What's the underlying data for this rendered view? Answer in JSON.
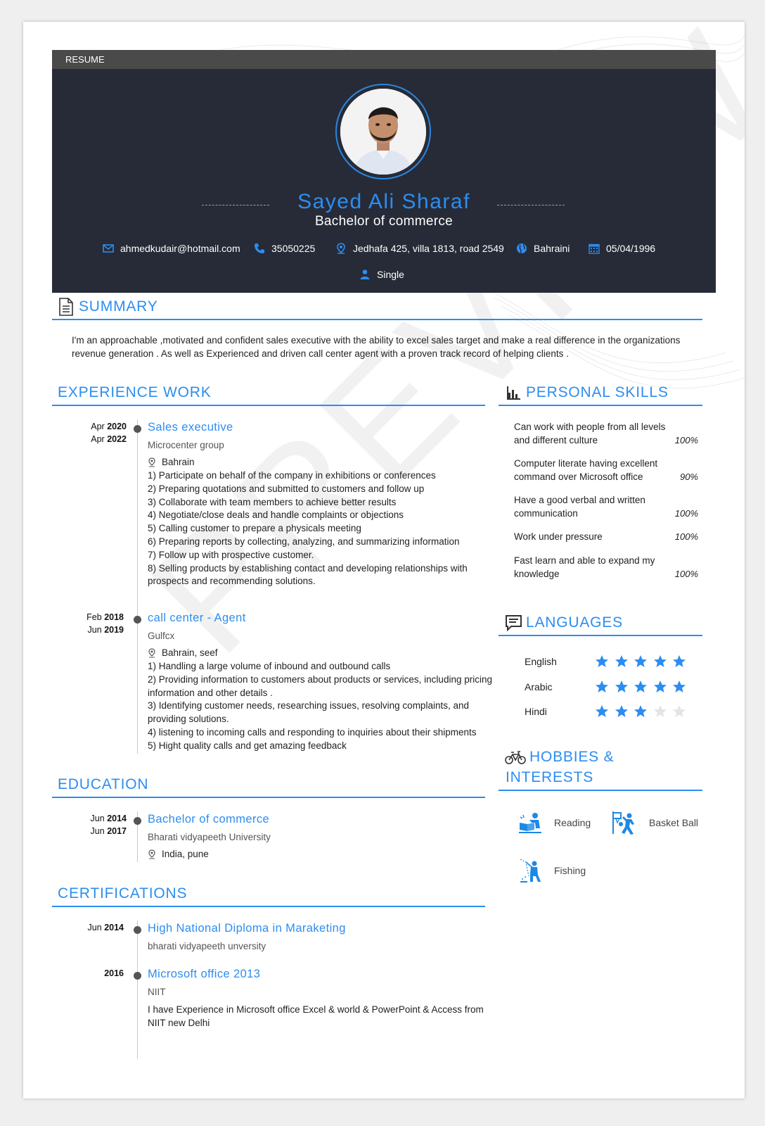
{
  "watermark": "PREVIEW",
  "topbar": {
    "label": "RESUME"
  },
  "header": {
    "name": "Sayed Ali Sharaf",
    "degree": "Bachelor of commerce",
    "email": "ahmedkudair@hotmail.com",
    "phone": "35050225",
    "address": "Jedhafa 425, villa 1813, road 2549",
    "nationality": "Bahraini",
    "dob": "05/04/1996",
    "marital": "Single"
  },
  "summary": {
    "title": "SUMMARY",
    "text": "I'm an approachable ,motivated and confident sales executive with the ability to excel sales target and make a real difference in the organizations revenue generation . As well as Experienced and driven call center agent with a proven track record of helping clients ."
  },
  "experience": {
    "title": "EXPERIENCE WORK",
    "jobs": [
      {
        "from_month": "Apr",
        "from_year": "2020",
        "to_month": "Apr",
        "to_year": "2022",
        "title": "Sales executive",
        "company": "Microcenter group",
        "location": "Bahrain",
        "duties": [
          "1) Participate on behalf of the company in exhibitions or conferences",
          "2) Preparing quotations and submitted to customers and follow up",
          "3) Collaborate with team members to achieve better results",
          "4) Negotiate/close deals and handle complaints or objections",
          "5) Calling customer to prepare a physicals meeting",
          "6) Preparing reports by collecting, analyzing, and summarizing information",
          "7) Follow up with prospective customer.",
          "8) Selling products by establishing contact and developing relationships with prospects and recommending solutions."
        ]
      },
      {
        "from_month": "Feb",
        "from_year": "2018",
        "to_month": "Jun",
        "to_year": "2019",
        "title": "call center - Agent",
        "company": "Gulfcx",
        "location": "Bahrain, seef",
        "duties": [
          "1) Handling a large volume of inbound and outbound calls",
          "2) Providing information to customers about products or services, including pricing information and other details .",
          "3) Identifying customer needs, researching issues, resolving complaints, and providing solutions.",
          "4) listening to incoming calls and responding to inquiries about their shipments",
          "5) Hight quality calls and get amazing feedback"
        ]
      }
    ]
  },
  "education": {
    "title": "EDUCATION",
    "items": [
      {
        "from_month": "Jun",
        "from_year": "2014",
        "to_month": "Jun",
        "to_year": "2017",
        "title": "Bachelor of commerce",
        "school": "Bharati vidyapeeth University",
        "location": "India, pune"
      }
    ]
  },
  "certifications": {
    "title": "CERTIFICATIONS",
    "items": [
      {
        "month": "Jun",
        "year": "2014",
        "title": "High National Diploma in Maraketing",
        "org": "bharati vidyapeeth unversity",
        "desc": ""
      },
      {
        "month": "",
        "year": "2016",
        "title": "Microsoft office 2013",
        "org": "NIIT",
        "desc": "I have Experience in Microsoft office Excel & world & PowerPoint & Access from NIIT new Delhi"
      }
    ]
  },
  "skills": {
    "title": "PERSONAL SKILLS",
    "items": [
      {
        "text": "Can work with people from all levels and different culture",
        "pct": "100%"
      },
      {
        "text": "Computer literate having excellent command over Microsoft office",
        "pct": "90%"
      },
      {
        "text": "Have a good verbal and written communication",
        "pct": "100%"
      },
      {
        "text": "Work under pressure",
        "pct": "100%"
      },
      {
        "text": "Fast learn and able to expand my knowledge",
        "pct": "100%"
      }
    ]
  },
  "languages": {
    "title": "LANGUAGES",
    "items": [
      {
        "name": "English",
        "rating": 5,
        "max": 5
      },
      {
        "name": "Arabic",
        "rating": 5,
        "max": 5
      },
      {
        "name": "Hindi",
        "rating": 3,
        "max": 5
      }
    ]
  },
  "hobbies": {
    "title_line1": "HOBBIES &",
    "title_line2": "INTERESTS",
    "items": [
      {
        "name": "Reading",
        "icon": "reading-icon"
      },
      {
        "name": "Basket Ball",
        "icon": "basketball-icon"
      },
      {
        "name": "Fishing",
        "icon": "fishing-icon"
      }
    ]
  },
  "colors": {
    "accent": "#2c8df0",
    "header_bg": "#262b37",
    "topbar_bg": "#4a4a4a"
  }
}
